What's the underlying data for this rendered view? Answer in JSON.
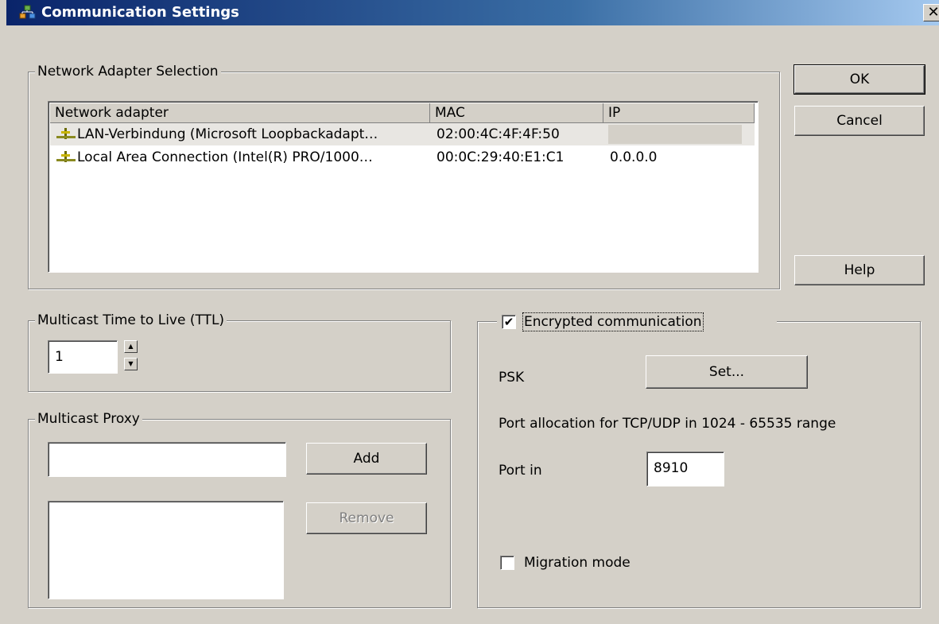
{
  "window": {
    "title": "Communication Settings"
  },
  "buttons": {
    "ok": "OK",
    "cancel": "Cancel",
    "help": "Help"
  },
  "network_adapter": {
    "group_label": "Network Adapter Selection",
    "columns": [
      "Network adapter",
      "MAC",
      "IP"
    ],
    "rows": [
      {
        "name": "LAN-Verbindung (Microsoft Loopbackadapt…",
        "mac": "02:00:4C:4F:4F:50",
        "ip": ""
      },
      {
        "name": "Local Area Connection (Intel(R) PRO/1000…",
        "mac": "00:0C:29:40:E1:C1",
        "ip": "0.0.0.0"
      }
    ]
  },
  "ttl": {
    "group_label": "Multicast Time to Live (TTL)",
    "value": "1"
  },
  "proxy": {
    "group_label": "Multicast Proxy",
    "input_value": "",
    "add_label": "Add",
    "remove_label": "Remove"
  },
  "encryption": {
    "checkbox_label": "Encrypted communication",
    "checked": true,
    "psk_label": "PSK",
    "set_label": "Set...",
    "port_range_text": "Port allocation for TCP/UDP in 1024 - 65535 range",
    "port_in_label": "Port in",
    "port_in_value": "8910",
    "migration_label": "Migration mode",
    "migration_checked": false
  },
  "icons": {
    "title": "network-settings-icon",
    "adapter": "network-adapter-icon",
    "close": "close-icon"
  }
}
